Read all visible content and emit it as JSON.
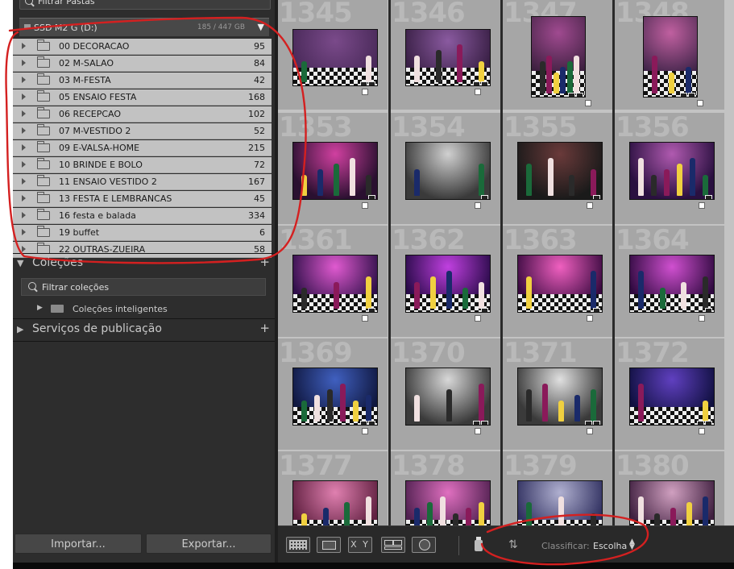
{
  "left_panel": {
    "filter_folders_placeholder": "Filtrar Pastas",
    "volume": {
      "name": "SSD M2 G (D:)",
      "size": "185 / 447 GB"
    },
    "folders": [
      {
        "name": "00 DECORACAO",
        "count": "95"
      },
      {
        "name": "02 M-SALAO",
        "count": "84"
      },
      {
        "name": "03 M-FESTA",
        "count": "42"
      },
      {
        "name": "05 ENSAIO FESTA",
        "count": "168"
      },
      {
        "name": "06 RECEPCAO",
        "count": "102"
      },
      {
        "name": "07 M-VESTIDO 2",
        "count": "52"
      },
      {
        "name": "09 E-VALSA-HOME",
        "count": "215"
      },
      {
        "name": "10 BRINDE E BOLO",
        "count": "72"
      },
      {
        "name": "11 ENSAIO VESTIDO 2",
        "count": "167"
      },
      {
        "name": "13 FESTA E LEMBRANCAS",
        "count": "45"
      },
      {
        "name": "16 festa e balada",
        "count": "334"
      },
      {
        "name": "19 buffet",
        "count": "6"
      },
      {
        "name": "22 OUTRAS-ZUEIRA",
        "count": "58"
      }
    ],
    "collections": {
      "title": "Coleções",
      "filter_placeholder": "Filtrar coleções",
      "smart_collections": "Coleções inteligentes"
    },
    "publish_services": {
      "title": "Serviços de publicação"
    },
    "import_label": "Importar...",
    "export_label": "Exportar..."
  },
  "grid": {
    "rows": [
      [
        "1345",
        "1346",
        "1347",
        "1348"
      ],
      [
        "1353",
        "1354",
        "1355",
        "1356"
      ],
      [
        "1361",
        "1362",
        "1363",
        "1364"
      ],
      [
        "1369",
        "1370",
        "1371",
        "1372"
      ],
      [
        "1377",
        "1378",
        "1379",
        "1380"
      ]
    ]
  },
  "toolbar": {
    "sort_label": "Classificar:",
    "sort_value": "Escolha",
    "xy_label": "X Y",
    "icons": [
      "grid-view-icon",
      "loupe-view-icon",
      "compare-view-icon",
      "survey-view-icon",
      "people-view-icon",
      "painter-icon",
      "sort-direction-icon"
    ]
  },
  "colors": {
    "panel_bg": "#2d2d2d",
    "folder_row_bg": "#c2c2c2",
    "grid_cell_bg": "#a6a6a6",
    "annotation_red": "#d42020"
  }
}
